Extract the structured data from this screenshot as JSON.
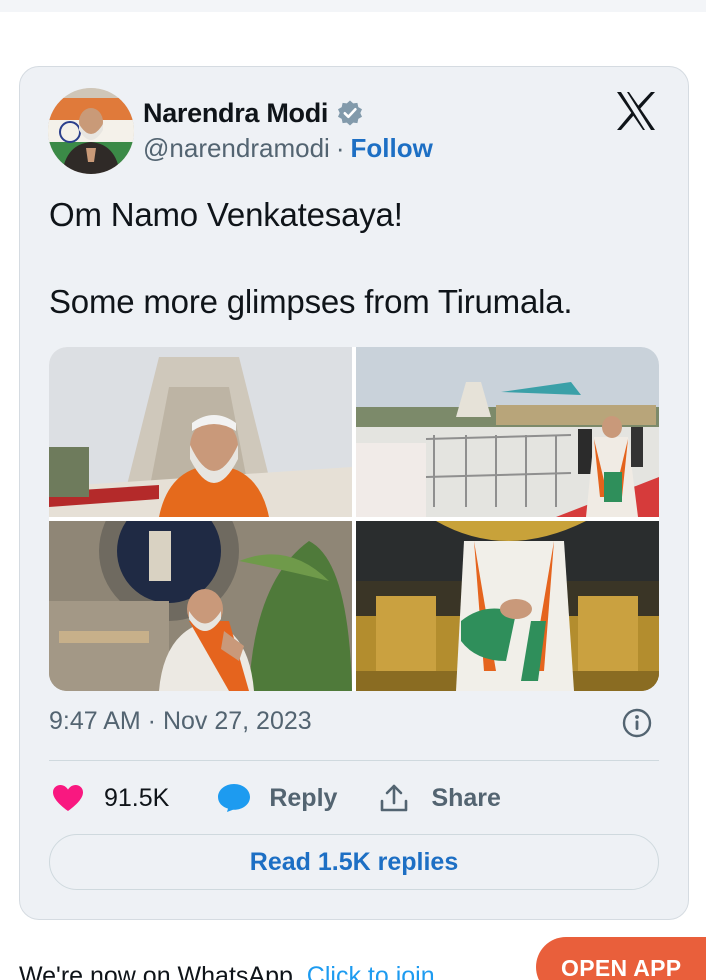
{
  "tweet": {
    "author_name": "Narendra Modi",
    "handle": "@narendramodi",
    "separator": "·",
    "follow_label": "Follow",
    "line1": "Om Namo Venkatesaya!",
    "line2": "Some more glimpses from Tirumala.",
    "timestamp": "9:47 AM · Nov 27, 2023",
    "likes_count": "91.5K",
    "reply_label": "Reply",
    "share_label": "Share",
    "read_replies_label": "Read 1.5K replies"
  },
  "footer": {
    "whatsapp_text": "We're now on WhatsApp.",
    "whatsapp_link": "Click to join",
    "open_app_label": "OPEN APP"
  },
  "colors": {
    "follow": "#1d6fc4",
    "verified": "#829aab",
    "like_heart": "#f91880",
    "reply_bubble": "#1d9bf0",
    "open_app_bg": "#e95f3b",
    "card_bg": "#eef1f5"
  },
  "icons": [
    "verified-badge-icon",
    "x-logo-icon",
    "info-icon",
    "heart-icon",
    "reply-bubble-icon",
    "share-icon"
  ]
}
